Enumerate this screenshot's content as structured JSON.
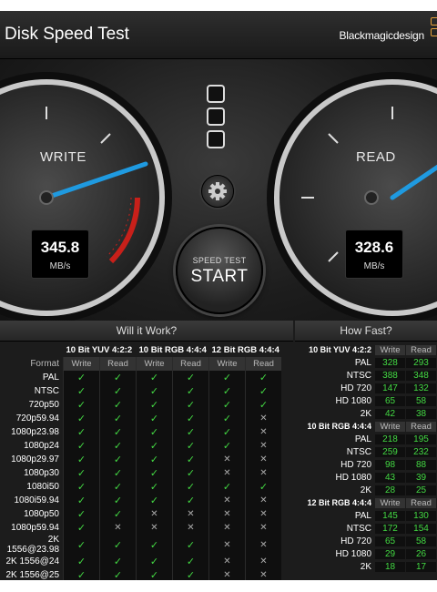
{
  "app": {
    "title": "Disk Speed Test",
    "brand": "Blackmagicdesign"
  },
  "gauges": {
    "write": {
      "label": "WRITE",
      "value": "345.8",
      "unit": "MB/s"
    },
    "read": {
      "label": "READ",
      "value": "328.6",
      "unit": "MB/s"
    }
  },
  "start_button": {
    "top": "SPEED TEST",
    "main": "START"
  },
  "will_it_work": {
    "title": "Will it Work?",
    "format_label": "Format",
    "groups": [
      "10 Bit YUV 4:2:2",
      "10 Bit RGB 4:4:4",
      "12 Bit RGB 4:4:4"
    ],
    "subheaders": [
      "Write",
      "Read",
      "Write",
      "Read",
      "Write",
      "Read"
    ],
    "rows": [
      {
        "format": "PAL",
        "cells": [
          "✓",
          "✓",
          "✓",
          "✓",
          "✓",
          "✓"
        ]
      },
      {
        "format": "NTSC",
        "cells": [
          "✓",
          "✓",
          "✓",
          "✓",
          "✓",
          "✓"
        ]
      },
      {
        "format": "720p50",
        "cells": [
          "✓",
          "✓",
          "✓",
          "✓",
          "✓",
          "✓"
        ]
      },
      {
        "format": "720p59.94",
        "cells": [
          "✓",
          "✓",
          "✓",
          "✓",
          "✓",
          "✕"
        ]
      },
      {
        "format": "1080p23.98",
        "cells": [
          "✓",
          "✓",
          "✓",
          "✓",
          "✓",
          "✕"
        ]
      },
      {
        "format": "1080p24",
        "cells": [
          "✓",
          "✓",
          "✓",
          "✓",
          "✓",
          "✕"
        ]
      },
      {
        "format": "1080p29.97",
        "cells": [
          "✓",
          "✓",
          "✓",
          "✓",
          "✕",
          "✕"
        ]
      },
      {
        "format": "1080p30",
        "cells": [
          "✓",
          "✓",
          "✓",
          "✓",
          "✕",
          "✕"
        ]
      },
      {
        "format": "1080i50",
        "cells": [
          "✓",
          "✓",
          "✓",
          "✓",
          "✓",
          "✓"
        ]
      },
      {
        "format": "1080i59.94",
        "cells": [
          "✓",
          "✓",
          "✓",
          "✓",
          "✕",
          "✕"
        ]
      },
      {
        "format": "1080p50",
        "cells": [
          "✓",
          "✓",
          "✕",
          "✕",
          "✕",
          "✕"
        ]
      },
      {
        "format": "1080p59.94",
        "cells": [
          "✓",
          "✕",
          "✕",
          "✕",
          "✕",
          "✕"
        ]
      },
      {
        "format": "2K 1556@23.98",
        "cells": [
          "✓",
          "✓",
          "✓",
          "✓",
          "✕",
          "✕"
        ]
      },
      {
        "format": "2K 1556@24",
        "cells": [
          "✓",
          "✓",
          "✓",
          "✓",
          "✕",
          "✕"
        ]
      },
      {
        "format": "2K 1556@25",
        "cells": [
          "✓",
          "✓",
          "✓",
          "✓",
          "✕",
          "✕"
        ]
      }
    ]
  },
  "how_fast": {
    "title": "How Fast?",
    "groups": [
      {
        "name": "10 Bit YUV 4:2:2",
        "write": "Write",
        "read": "Read",
        "rows": [
          [
            "PAL",
            "328",
            "293"
          ],
          [
            "NTSC",
            "388",
            "348"
          ],
          [
            "HD 720",
            "147",
            "132"
          ],
          [
            "HD 1080",
            "65",
            "58"
          ],
          [
            "2K",
            "42",
            "38"
          ]
        ]
      },
      {
        "name": "10 Bit RGB 4:4:4",
        "write": "Write",
        "read": "Read",
        "rows": [
          [
            "PAL",
            "218",
            "195"
          ],
          [
            "NTSC",
            "259",
            "232"
          ],
          [
            "HD 720",
            "98",
            "88"
          ],
          [
            "HD 1080",
            "43",
            "39"
          ],
          [
            "2K",
            "28",
            "25"
          ]
        ]
      },
      {
        "name": "12 Bit RGB 4:4:4",
        "write": "Write",
        "read": "Read",
        "rows": [
          [
            "PAL",
            "145",
            "130"
          ],
          [
            "NTSC",
            "172",
            "154"
          ],
          [
            "HD 720",
            "65",
            "58"
          ],
          [
            "HD 1080",
            "29",
            "26"
          ],
          [
            "2K",
            "18",
            "17"
          ]
        ]
      }
    ]
  }
}
